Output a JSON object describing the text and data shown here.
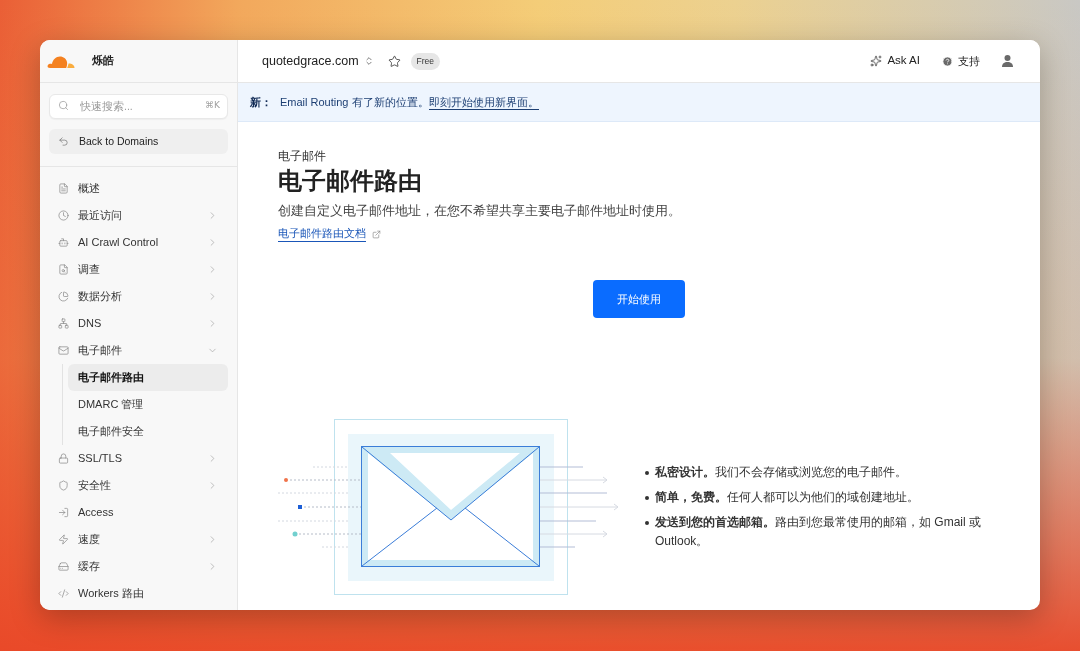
{
  "sidebar": {
    "account_name": "烁皓",
    "search": {
      "placeholder": "快速搜索...",
      "shortcut": "⌘K"
    },
    "back_button": "Back to Domains",
    "items": [
      {
        "label": "概述",
        "selected": false
      },
      {
        "label": "最近访问",
        "selected": false,
        "expanded": false
      },
      {
        "label": "AI Crawl Control",
        "selected": false,
        "expanded": false
      },
      {
        "label": "调查",
        "selected": false,
        "expanded": false
      },
      {
        "label": "数据分析",
        "selected": false,
        "expanded": false
      },
      {
        "label": "DNS",
        "selected": false,
        "expanded": false
      },
      {
        "label": "电子邮件",
        "selected": false,
        "expanded": true,
        "children": [
          {
            "label": "电子邮件路由",
            "selected": true
          },
          {
            "label": "DMARC 管理",
            "selected": false
          },
          {
            "label": "电子邮件安全",
            "selected": false
          }
        ]
      },
      {
        "label": "SSL/TLS",
        "selected": false,
        "expanded": false
      },
      {
        "label": "安全性",
        "selected": false,
        "expanded": false
      },
      {
        "label": "Access",
        "selected": false
      },
      {
        "label": "速度",
        "selected": false,
        "expanded": false
      },
      {
        "label": "缓存",
        "selected": false,
        "expanded": false
      },
      {
        "label": "Workers 路由",
        "selected": false
      }
    ]
  },
  "top_bar": {
    "domain": "quotedgrace.com",
    "starred": false,
    "plan": "Free",
    "ask_ai": "Ask AI",
    "support": "支持"
  },
  "notice": {
    "label": "新：",
    "text": "Email Routing 有了新的位置。",
    "link": "即刻开始使用新界面。"
  },
  "page": {
    "section": "电子邮件",
    "title": "电子邮件路由",
    "description": "创建自定义电子邮件地址，在您不希望共享主要电子邮件地址时使用。",
    "docs_link": "电子邮件路由文档",
    "primary_button": "开始使用",
    "features": [
      "**私密设计。**我们不会存储或浏览您的电子邮件。",
      "**简单，免费。**任何人都可以为他们的域创建地址。",
      "**发送到您的首选邮箱。**路由到您最常使用的邮箱，如 Gmail 或 Outlook。"
    ]
  }
}
